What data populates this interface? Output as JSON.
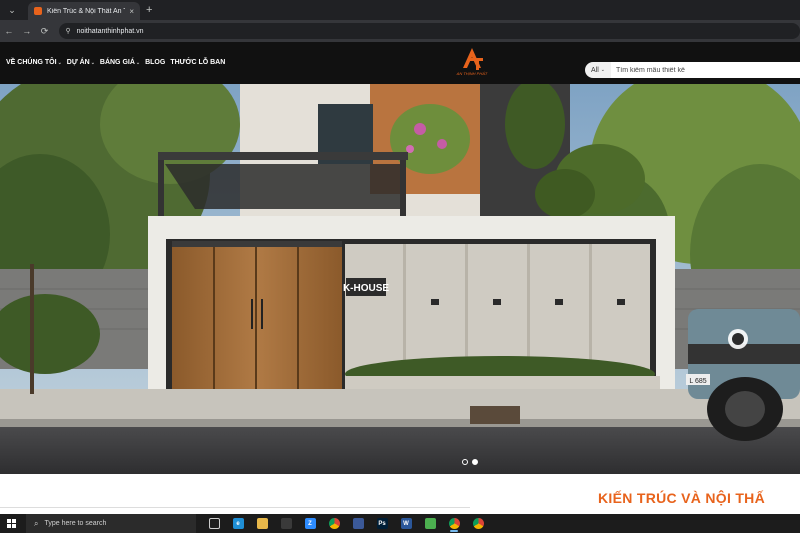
{
  "browser": {
    "tab_title": "Kiến Trúc & Nội Thất An Thịnh",
    "tab_close": "×",
    "new_tab": "+",
    "tab_menu": "⌄",
    "back": "←",
    "forward": "→",
    "reload": "⟳",
    "site_info": "⚲",
    "url": "noithatanthinhphat.vn"
  },
  "site": {
    "menu": [
      {
        "label": "VỀ CHÚNG TÔI",
        "dropdown": true
      },
      {
        "label": "DỰ ÁN",
        "dropdown": true
      },
      {
        "label": "BÁNG GIÁ",
        "dropdown": true
      },
      {
        "label": "BLOG",
        "dropdown": false
      },
      {
        "label": "THƯỚC LỖ BAN",
        "dropdown": false
      }
    ],
    "caret": "⌄",
    "logo_text": "AN THỊNH PHÁT",
    "search": {
      "category": "All",
      "placeholder": "Tìm kiếm mẫu thiết kế"
    },
    "colors": {
      "accent": "#e8631c",
      "header_bg": "#111111"
    }
  },
  "hero": {
    "sign_text": "K-HOUSE",
    "plate_text": "L 685",
    "slides": 2,
    "active_slide": 2
  },
  "content": {
    "heading": "KIẾN TRÚC VÀ NỘI THẤ"
  },
  "taskbar": {
    "search_placeholder": "Type here to search",
    "apps": [
      {
        "icon": "task-view-icon",
        "label": "",
        "color": "#1c1c1c",
        "active": false
      },
      {
        "icon": "edge-icon",
        "label": "e",
        "color": "#1f8fd6",
        "active": false
      },
      {
        "icon": "file-explorer-icon",
        "label": "",
        "color": "#e8b84a",
        "active": false
      },
      {
        "icon": "snip-icon",
        "label": "",
        "color": "#3a3a3a",
        "active": false
      },
      {
        "icon": "zoom-icon",
        "label": "Z",
        "color": "#2d8cff",
        "active": false
      },
      {
        "icon": "chrome-icon",
        "label": "",
        "color": "#db4437",
        "active": false
      },
      {
        "icon": "pen-icon",
        "label": "",
        "color": "#3b5998",
        "active": false
      },
      {
        "icon": "photoshop-icon",
        "label": "Ps",
        "color": "#001e36",
        "active": false
      },
      {
        "icon": "word-icon",
        "label": "W",
        "color": "#2b579a",
        "active": false
      },
      {
        "icon": "photos-icon",
        "label": "",
        "color": "#4caf50",
        "active": false
      },
      {
        "icon": "chrome-icon",
        "label": "",
        "color": "#db4437",
        "active": true
      },
      {
        "icon": "chrome-icon",
        "label": "",
        "color": "#db4437",
        "active": false
      }
    ]
  }
}
